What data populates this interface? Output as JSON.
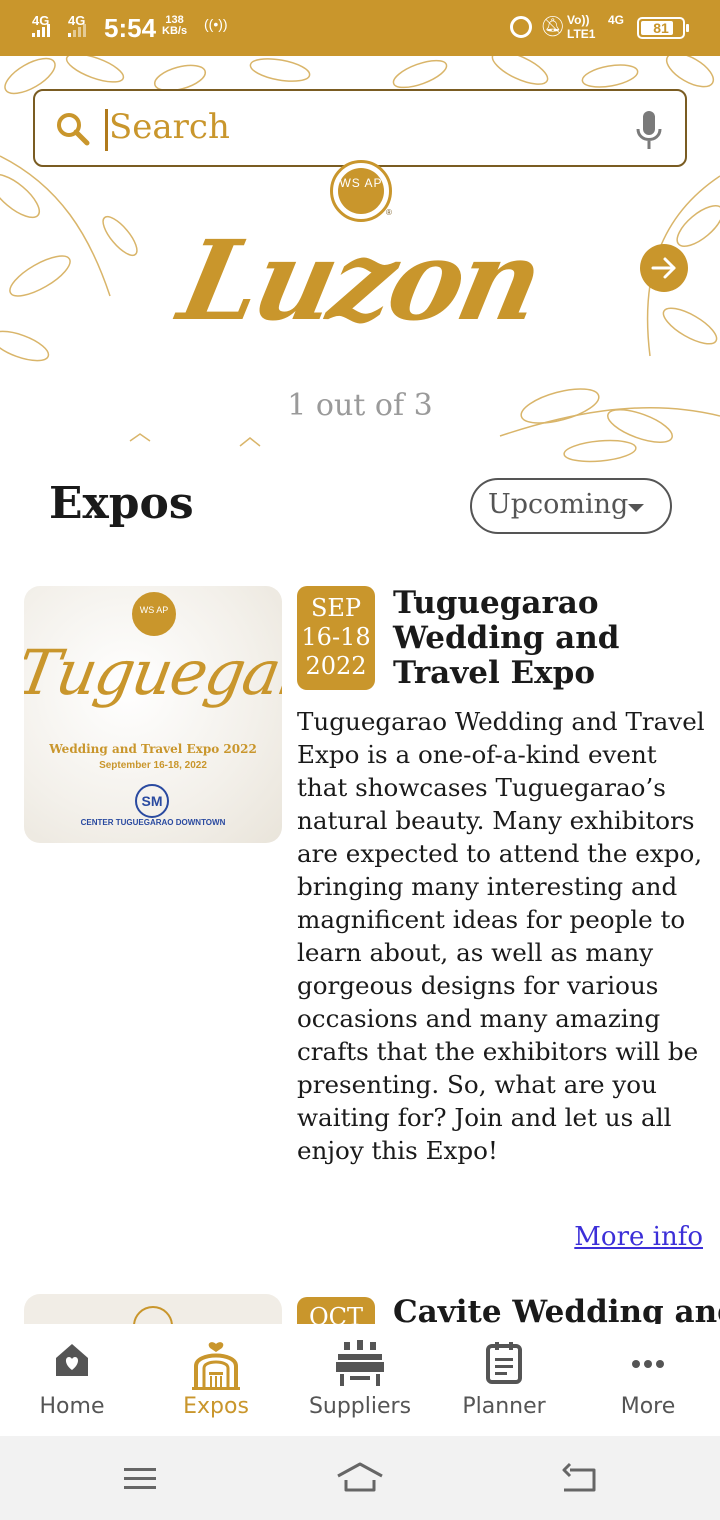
{
  "status_bar": {
    "network_1": "4G",
    "network_2": "4G",
    "time": "5:54",
    "speed_value": "138",
    "speed_unit": "KB/s",
    "volte": "Vo)) LTE1",
    "network_4g": "4G",
    "battery": "81",
    "battery_level": 0.81
  },
  "search": {
    "placeholder": "Search"
  },
  "banner": {
    "logo_text": "WS AP",
    "registered_mark": "®",
    "region": "Luzon",
    "counter": "1 out of 3"
  },
  "expos": {
    "title": "Expos",
    "filter_selected": "Upcoming"
  },
  "expo_cards": [
    {
      "month": "SEP",
      "days": "16-18",
      "year": "2022",
      "title": "Tuguegarao Wedding and Travel Expo",
      "description": "Tuguegarao Wedding and Travel Expo is a one-of-a-kind event that showcases Tuguegarao’s natural beauty. Many exhibitors are expected to attend the expo, bringing many interesting and magnificent ideas for people to learn about, as well as many gorgeous designs for various occasions and many amazing crafts that the exhibitors will be presenting. So, what are you waiting for? Join and let us all enjoy this Expo!",
      "more_info": "More info",
      "image": {
        "logo": "WS AP",
        "script": "Tuguegarao",
        "subtitle": "Wedding and Travel Expo 2022",
        "date": "September 16-18, 2022",
        "sm_logo": "SM",
        "venue": "CENTER TUGUEGARAO DOWNTOWN"
      }
    },
    {
      "month": "OCT",
      "title": "Cavite Wedding and"
    }
  ],
  "bottom_nav": {
    "items": [
      {
        "label": "Home",
        "icon": "home-heart-icon"
      },
      {
        "label": "Expos",
        "icon": "expo-arch-icon"
      },
      {
        "label": "Suppliers",
        "icon": "suppliers-table-icon"
      },
      {
        "label": "Planner",
        "icon": "planner-note-icon"
      },
      {
        "label": "More",
        "icon": "more-dots-icon"
      }
    ],
    "active": "Expos"
  },
  "colors": {
    "brand_gold": "#c9962c",
    "link_blue": "#3c2fd8",
    "text_dark": "#1a1a1a"
  }
}
